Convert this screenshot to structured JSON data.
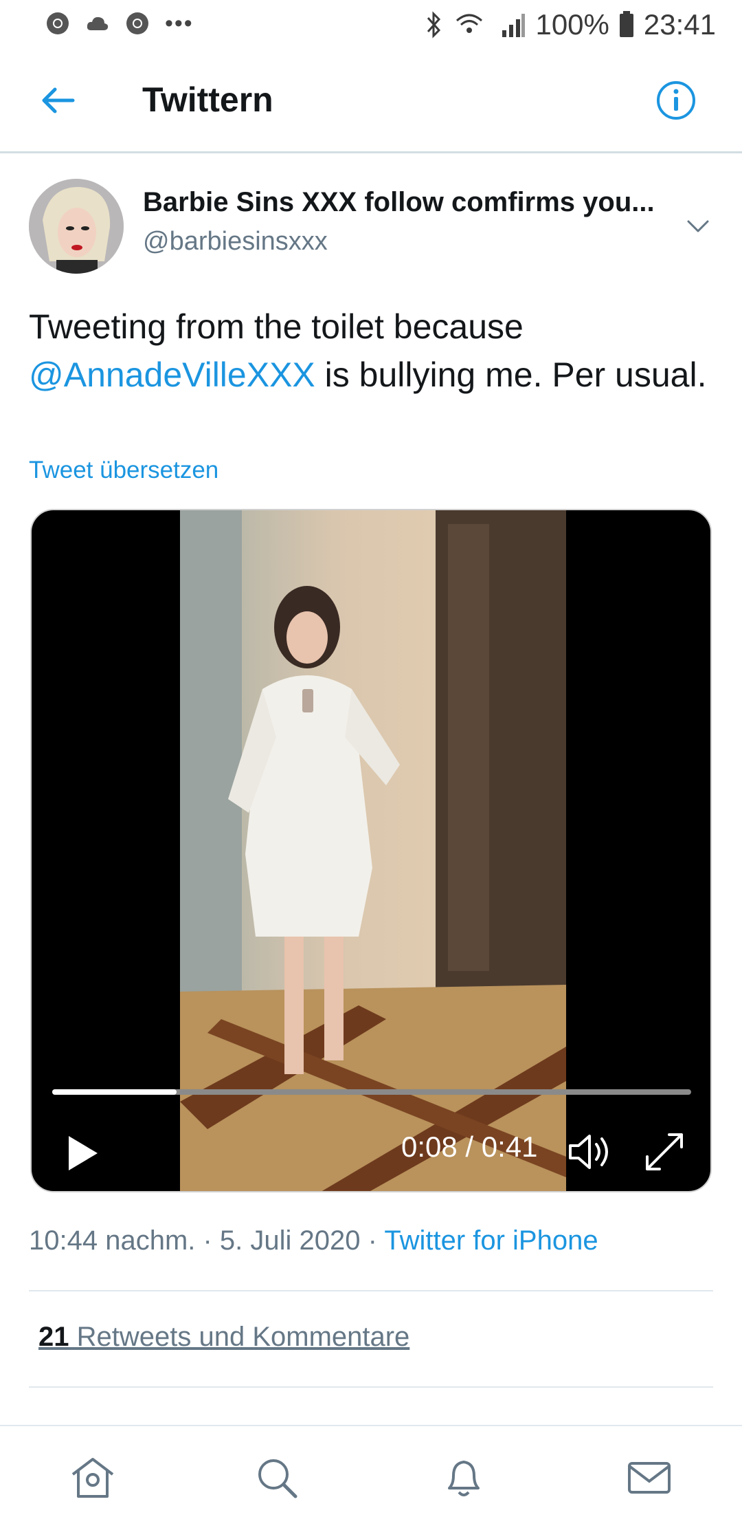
{
  "status_bar": {
    "battery": "100%",
    "time": "23:41",
    "left_icons": [
      "chrome-icon",
      "cloud-icon",
      "chrome-icon",
      "more-dots-icon"
    ],
    "right_icons": [
      "bluetooth-icon",
      "wifi-icon",
      "signal-icon",
      "battery-icon"
    ]
  },
  "header": {
    "title": "Twittern",
    "back_icon": "arrow-left-icon",
    "info_icon": "info-icon",
    "accent": "#1b95e0"
  },
  "tweet": {
    "display_name": "Barbie Sins XXX follow comfirms you...",
    "handle": "@barbiesinsxxx",
    "text_before": "Tweeting from the toilet because ",
    "mention": "@AnnadeVilleXXX",
    "text_after": " is bullying me. Per usual.",
    "translate": "Tweet übersetzen",
    "timestamp": "10:44 nachm. · 5. Juli 2020 · ",
    "source": "Twitter for iPhone",
    "retweet_count": "21",
    "retweet_label": " Retweets und Kommentare"
  },
  "video": {
    "current_time": "0:08 / 0:41",
    "progress": 0.195
  },
  "bottom_nav": {
    "items": [
      "home-icon",
      "search-icon",
      "notifications-icon",
      "messages-icon"
    ]
  }
}
